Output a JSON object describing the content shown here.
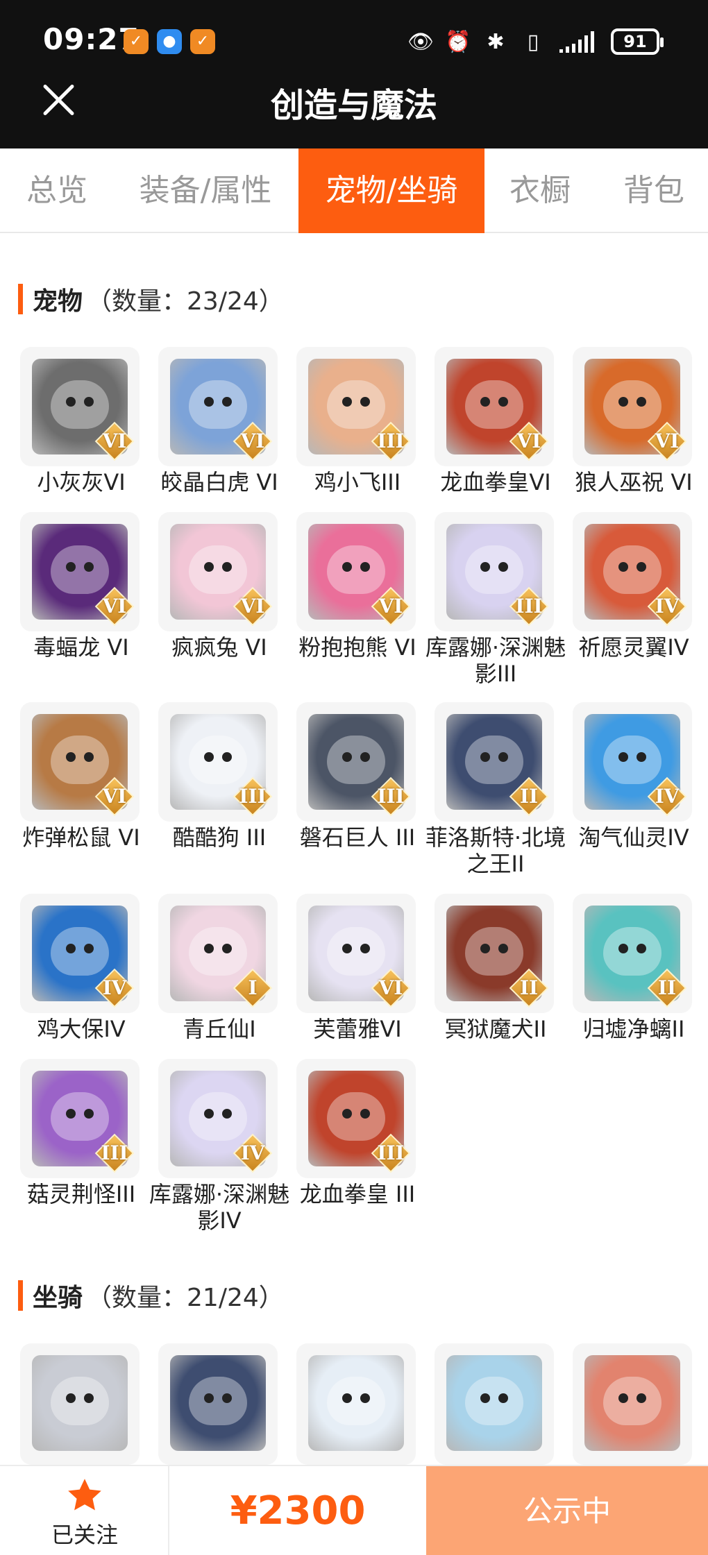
{
  "status_bar": {
    "time": "09:27",
    "battery": "91",
    "notif_icons": [
      "app-icon-orange",
      "chat-icon-blue",
      "app-icon-orange"
    ],
    "right_icons": [
      "eye-icon",
      "alarm-icon",
      "bluetooth-icon",
      "vibrate-icon",
      "signal-icon"
    ]
  },
  "header": {
    "title": "创造与魔法",
    "close_icon": "close-icon"
  },
  "tabs": [
    "总览",
    "装备/属性",
    "宠物/坐骑",
    "衣橱",
    "背包"
  ],
  "active_tab": 2,
  "pets": {
    "label": "宠物",
    "count_text": "（数量：23/24）",
    "items": [
      {
        "name": "小灰灰VI",
        "rank": "VI",
        "color": "#6d6d6d"
      },
      {
        "name": "皎晶白虎 VI",
        "rank": "VI",
        "color": "#7da3d8"
      },
      {
        "name": "鸡小飞III",
        "rank": "III",
        "color": "#e9b08c"
      },
      {
        "name": "龙血拳皇VI",
        "rank": "VI",
        "color": "#c0442c"
      },
      {
        "name": "狼人巫祝 VI",
        "rank": "VI",
        "color": "#d86a2a"
      },
      {
        "name": "毒蝠龙 VI",
        "rank": "VI",
        "color": "#5a2a7a"
      },
      {
        "name": "疯疯兔 VI",
        "rank": "VI",
        "color": "#f2c6d6"
      },
      {
        "name": "粉抱抱熊 VI",
        "rank": "VI",
        "color": "#ea6f9a"
      },
      {
        "name": "库露娜·深渊魅影III",
        "rank": "III",
        "color": "#d8d2f0"
      },
      {
        "name": "祈愿灵翼IV",
        "rank": "IV",
        "color": "#d85a3a"
      },
      {
        "name": "炸弹松鼠 VI",
        "rank": "VI",
        "color": "#b77a45"
      },
      {
        "name": "酷酷狗 III",
        "rank": "III",
        "color": "#eef1f6"
      },
      {
        "name": "磐石巨人 III",
        "rank": "III",
        "color": "#4c5566"
      },
      {
        "name": "菲洛斯特·北境之王II",
        "rank": "II",
        "color": "#3e4d70"
      },
      {
        "name": "淘气仙灵IV",
        "rank": "IV",
        "color": "#3f9be3"
      },
      {
        "name": "鸡大保IV",
        "rank": "IV",
        "color": "#2a73c8"
      },
      {
        "name": "青丘仙I",
        "rank": "I",
        "color": "#f0d6e2"
      },
      {
        "name": "芙蕾雅VI",
        "rank": "VI",
        "color": "#e6e2f2"
      },
      {
        "name": "冥狱魔犬II",
        "rank": "II",
        "color": "#8a3a2a"
      },
      {
        "name": "归墟净螭II",
        "rank": "II",
        "color": "#59c2c0"
      },
      {
        "name": "菇灵荆怪III",
        "rank": "III",
        "color": "#9b63c8"
      },
      {
        "name": "库露娜·深渊魅影IV",
        "rank": "IV",
        "color": "#dcd6f2"
      },
      {
        "name": "龙血拳皇 III",
        "rank": "III",
        "color": "#c0442c"
      }
    ]
  },
  "mounts": {
    "label": "坐骑",
    "count_text": "（数量：21/24）",
    "items": [
      {
        "color": "#c9ccd4"
      },
      {
        "color": "#3e4d70"
      },
      {
        "color": "#e6eef6"
      },
      {
        "color": "#a9d3ea"
      },
      {
        "color": "#e2836e"
      }
    ]
  },
  "bottom": {
    "follow_label": "已关注",
    "price": "¥2300",
    "status_label": "公示中",
    "accent": "#fd5d10"
  }
}
